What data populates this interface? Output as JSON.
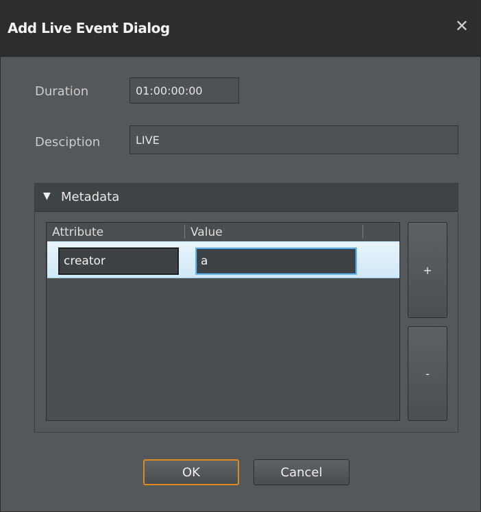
{
  "dialog": {
    "title": "Add Live Event Dialog",
    "close_glyph": "✕",
    "close_icon": "close-icon"
  },
  "form": {
    "duration_label": "Duration",
    "duration_value": "01:00:00:00",
    "description_label": "Desciption",
    "description_value": "LIVE"
  },
  "metadata": {
    "arrow_glyph": "▼",
    "arrow_icon": "triangle-down-icon",
    "title": "Metadata",
    "columns": [
      "Attribute",
      "Value"
    ],
    "rows": [
      {
        "attribute": "creator",
        "value": "a"
      }
    ],
    "add_label": "+",
    "remove_label": "-"
  },
  "buttons": {
    "ok_label": "OK",
    "cancel_label": "Cancel"
  },
  "colors": {
    "ok_focus_border": "#e08a1e",
    "row_selection": "#cfe8f7",
    "value_focus_border": "#6fb3e6"
  }
}
